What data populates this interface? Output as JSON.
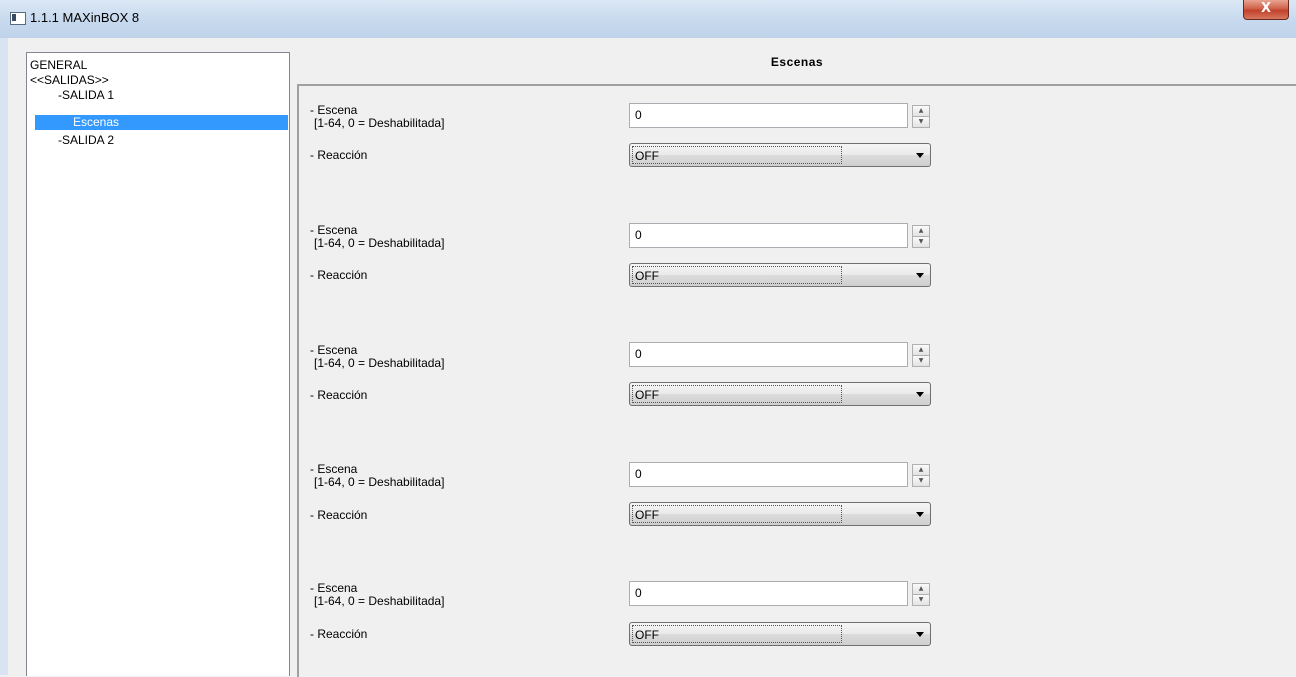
{
  "window": {
    "title": "1.1.1 MAXinBOX 8",
    "close_label": "X"
  },
  "tree": {
    "items": [
      {
        "label": "GENERAL",
        "selected": false
      },
      {
        "label": "<<SALIDAS>>",
        "selected": false
      },
      {
        "label": "-SALIDA 1",
        "selected": false
      },
      {
        "label": "Escenas",
        "selected": true
      },
      {
        "label": "-SALIDA 2",
        "selected": false
      }
    ]
  },
  "panel": {
    "title": "Escenas",
    "groups": [
      {
        "scene_label": "- Escena",
        "scene_range": "[1-64, 0 = Deshabilitada]",
        "scene_value": "0",
        "reaction_label": "- Reacción",
        "reaction_value": "OFF"
      },
      {
        "scene_label": "- Escena",
        "scene_range": "[1-64, 0 = Deshabilitada]",
        "scene_value": "0",
        "reaction_label": "- Reacción",
        "reaction_value": "OFF"
      },
      {
        "scene_label": "- Escena",
        "scene_range": "[1-64, 0 = Deshabilitada]",
        "scene_value": "0",
        "reaction_label": "- Reacción",
        "reaction_value": "OFF"
      },
      {
        "scene_label": "- Escena",
        "scene_range": "[1-64, 0 = Deshabilitada]",
        "scene_value": "0",
        "reaction_label": "- Reacción",
        "reaction_value": "OFF"
      },
      {
        "scene_label": "- Escena",
        "scene_range": "[1-64, 0 = Deshabilitada]",
        "scene_value": "0",
        "reaction_label": "- Reacción",
        "reaction_value": "OFF"
      }
    ]
  },
  "colors": {
    "selection": "#3399ff",
    "titlebar": "#c7d9ee",
    "close": "#c2412a"
  },
  "icons": {
    "app": "window-app-icon",
    "close": "close-icon",
    "spin_up": "spin-up-icon",
    "spin_down": "spin-down-icon",
    "dropdown": "chevron-down-icon"
  }
}
